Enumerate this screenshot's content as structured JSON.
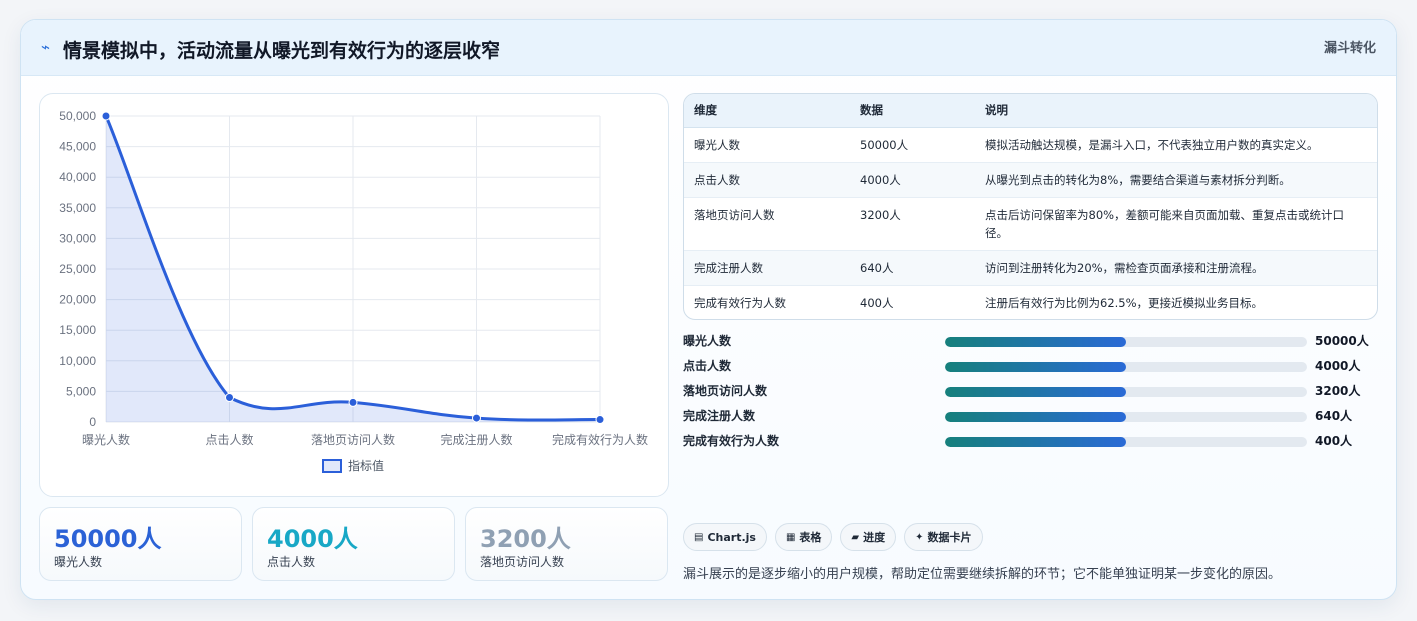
{
  "header": {
    "icon": "wave-icon",
    "title": "情景模拟中，活动流量从曝光到有效行为的逐层收窄",
    "tag": "漏斗转化"
  },
  "colors": {
    "line": "#2b5fd9",
    "fill": "rgba(43,95,217,0.14)",
    "kpi1": "#2b62d6",
    "kpi2": "#18a8c6",
    "kpi3": "#8fa0b3"
  },
  "chart_data": {
    "type": "line",
    "categories": [
      "曝光人数",
      "点击人数",
      "落地页访问人数",
      "完成注册人数",
      "完成有效行为人数"
    ],
    "series": [
      {
        "name": "指标值",
        "values": [
          50000,
          4000,
          3200,
          640,
          400
        ]
      }
    ],
    "yticks": [
      "0",
      "5,000",
      "10,000",
      "15,000",
      "20,000",
      "25,000",
      "30,000",
      "35,000",
      "40,000",
      "45,000",
      "50,000"
    ],
    "ylim": [
      0,
      50000
    ],
    "grid": true,
    "legend": "bottom",
    "fill": true,
    "smooth": true
  },
  "kpis": [
    {
      "value": "50000人",
      "label": "曝光人数"
    },
    {
      "value": "4000人",
      "label": "点击人数"
    },
    {
      "value": "3200人",
      "label": "落地页访问人数"
    }
  ],
  "table": {
    "headers": [
      "维度",
      "数据",
      "说明"
    ],
    "rows": [
      [
        "曝光人数",
        "50000人",
        "模拟活动触达规模，是漏斗入口，不代表独立用户数的真实定义。"
      ],
      [
        "点击人数",
        "4000人",
        "从曝光到点击的转化为8%，需要结合渠道与素材拆分判断。"
      ],
      [
        "落地页访问人数",
        "3200人",
        "点击后访问保留率为80%，差额可能来自页面加载、重复点击或统计口径。"
      ],
      [
        "完成注册人数",
        "640人",
        "访问到注册转化为20%，需检查页面承接和注册流程。"
      ],
      [
        "完成有效行为人数",
        "400人",
        "注册后有效行为比例为62.5%，更接近模拟业务目标。"
      ]
    ]
  },
  "progress": [
    {
      "label": "曝光人数",
      "value": "50000人",
      "level": 0.5
    },
    {
      "label": "点击人数",
      "value": "4000人",
      "level": 0.5
    },
    {
      "label": "落地页访问人数",
      "value": "3200人",
      "level": 0.5
    },
    {
      "label": "完成注册人数",
      "value": "640人",
      "level": 0.5
    },
    {
      "label": "完成有效行为人数",
      "value": "400人",
      "level": 0.5
    }
  ],
  "pills": [
    {
      "icon": "chart-icon",
      "glyph": "▤",
      "label": "Chart.js"
    },
    {
      "icon": "table-icon",
      "glyph": "▦",
      "label": "表格"
    },
    {
      "icon": "progress-icon",
      "glyph": "▰",
      "label": "进度"
    },
    {
      "icon": "sparkle-icon",
      "glyph": "✦",
      "label": "数据卡片"
    }
  ],
  "footnote": "漏斗展示的是逐步缩小的用户规模，帮助定位需要继续拆解的环节；它不能单独证明某一步变化的原因。"
}
